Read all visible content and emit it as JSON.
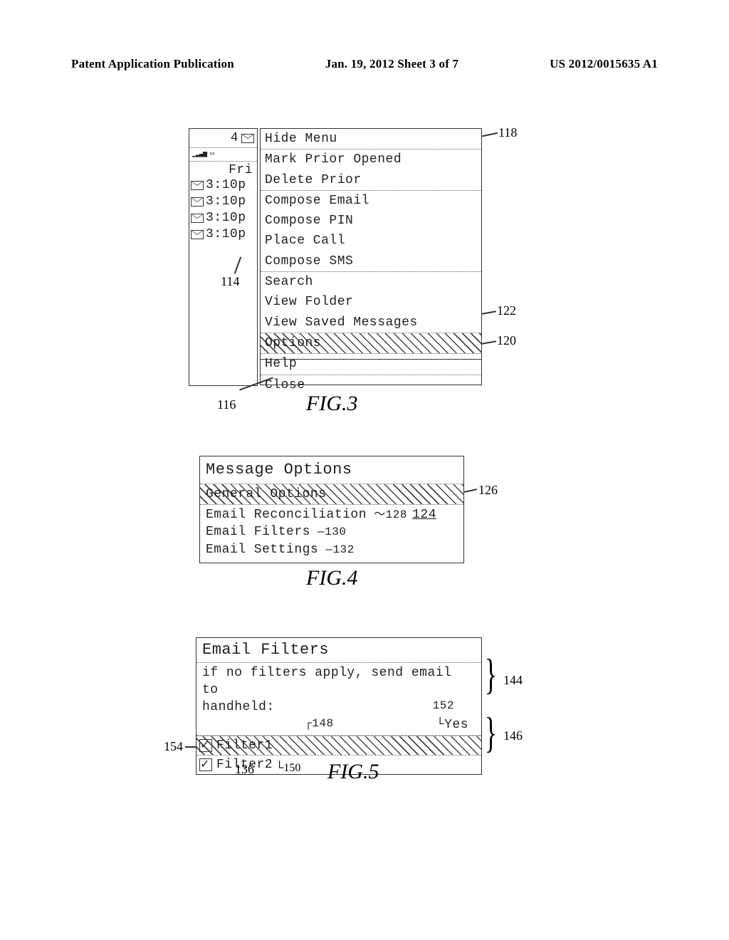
{
  "header": {
    "left": "Patent Application Publication",
    "center": "Jan. 19, 2012  Sheet 3 of 7",
    "right": "US 2012/0015635 A1"
  },
  "fig3": {
    "status_count": "4",
    "day": "Fri",
    "msg_times": [
      "3:10p",
      "3:10p",
      "3:10p",
      "3:10p"
    ],
    "menu": {
      "hide": "Hide Menu",
      "mark_prior": "Mark Prior Opened",
      "delete_prior": "Delete Prior",
      "compose_email": "Compose Email",
      "compose_pin": "Compose PIN",
      "place_call": "Place Call",
      "compose_sms": "Compose SMS",
      "search": "Search",
      "view_folder": "View Folder",
      "view_saved": "View Saved Messages",
      "options": "Options",
      "help": "Help",
      "close": "Close"
    },
    "callouts": {
      "c114": "114",
      "c116": "116",
      "c118": "118",
      "c120": "120",
      "c122": "122"
    },
    "caption": "FIG.3"
  },
  "fig4": {
    "title": "Message Options",
    "general": "General Options",
    "rows": {
      "reconciliation": "Email Reconciliation",
      "filters": "Email Filters",
      "settings": "Email Settings"
    },
    "callouts": {
      "c124": "124",
      "c126": "126",
      "c128": "128",
      "c130": "130",
      "c132": "132"
    },
    "caption": "FIG.4"
  },
  "fig5": {
    "title": "Email Filters",
    "body_line1": "if no filters apply, send email to",
    "body_line2": "handheld:",
    "yes": "Yes",
    "filter1": "Filter1",
    "filter2": "Filter2",
    "callouts": {
      "c136": "136",
      "c144": "144",
      "c146": "146",
      "c148": "148",
      "c150": "150",
      "c152": "152",
      "c154": "154"
    },
    "caption": "FIG.5"
  }
}
